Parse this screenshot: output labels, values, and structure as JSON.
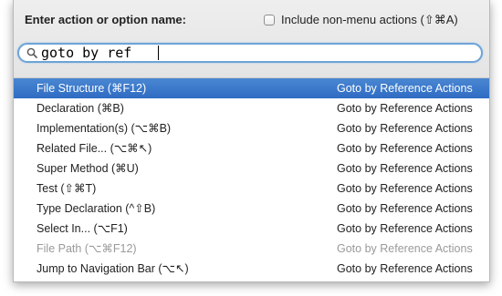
{
  "header": {
    "prompt_label": "Enter action or option name:",
    "include_checkbox": {
      "label": "Include non-menu actions (⇧⌘A)",
      "checked": false
    }
  },
  "search": {
    "value": "goto by ref",
    "icon": "search-icon"
  },
  "results": [
    {
      "name": "File Structure (⌘F12)",
      "group": "Goto by Reference Actions",
      "selected": true,
      "disabled": false
    },
    {
      "name": "Declaration (⌘B)",
      "group": "Goto by Reference Actions",
      "selected": false,
      "disabled": false
    },
    {
      "name": "Implementation(s) (⌥⌘B)",
      "group": "Goto by Reference Actions",
      "selected": false,
      "disabled": false
    },
    {
      "name": "Related File... (⌥⌘↖)",
      "group": "Goto by Reference Actions",
      "selected": false,
      "disabled": false
    },
    {
      "name": "Super Method (⌘U)",
      "group": "Goto by Reference Actions",
      "selected": false,
      "disabled": false
    },
    {
      "name": "Test (⇧⌘T)",
      "group": "Goto by Reference Actions",
      "selected": false,
      "disabled": false
    },
    {
      "name": "Type Declaration (^⇧B)",
      "group": "Goto by Reference Actions",
      "selected": false,
      "disabled": false
    },
    {
      "name": "Select In... (⌥F1)",
      "group": "Goto by Reference Actions",
      "selected": false,
      "disabled": false
    },
    {
      "name": "File Path (⌥⌘F12)",
      "group": "Goto by Reference Actions",
      "selected": false,
      "disabled": true
    },
    {
      "name": "Jump to Navigation Bar (⌥↖)",
      "group": "Goto by Reference Actions",
      "selected": false,
      "disabled": false
    }
  ],
  "colors": {
    "selection": "#3b78c9",
    "disabled_text": "#9a9a9a",
    "field_focus": "#6ea3d6"
  }
}
